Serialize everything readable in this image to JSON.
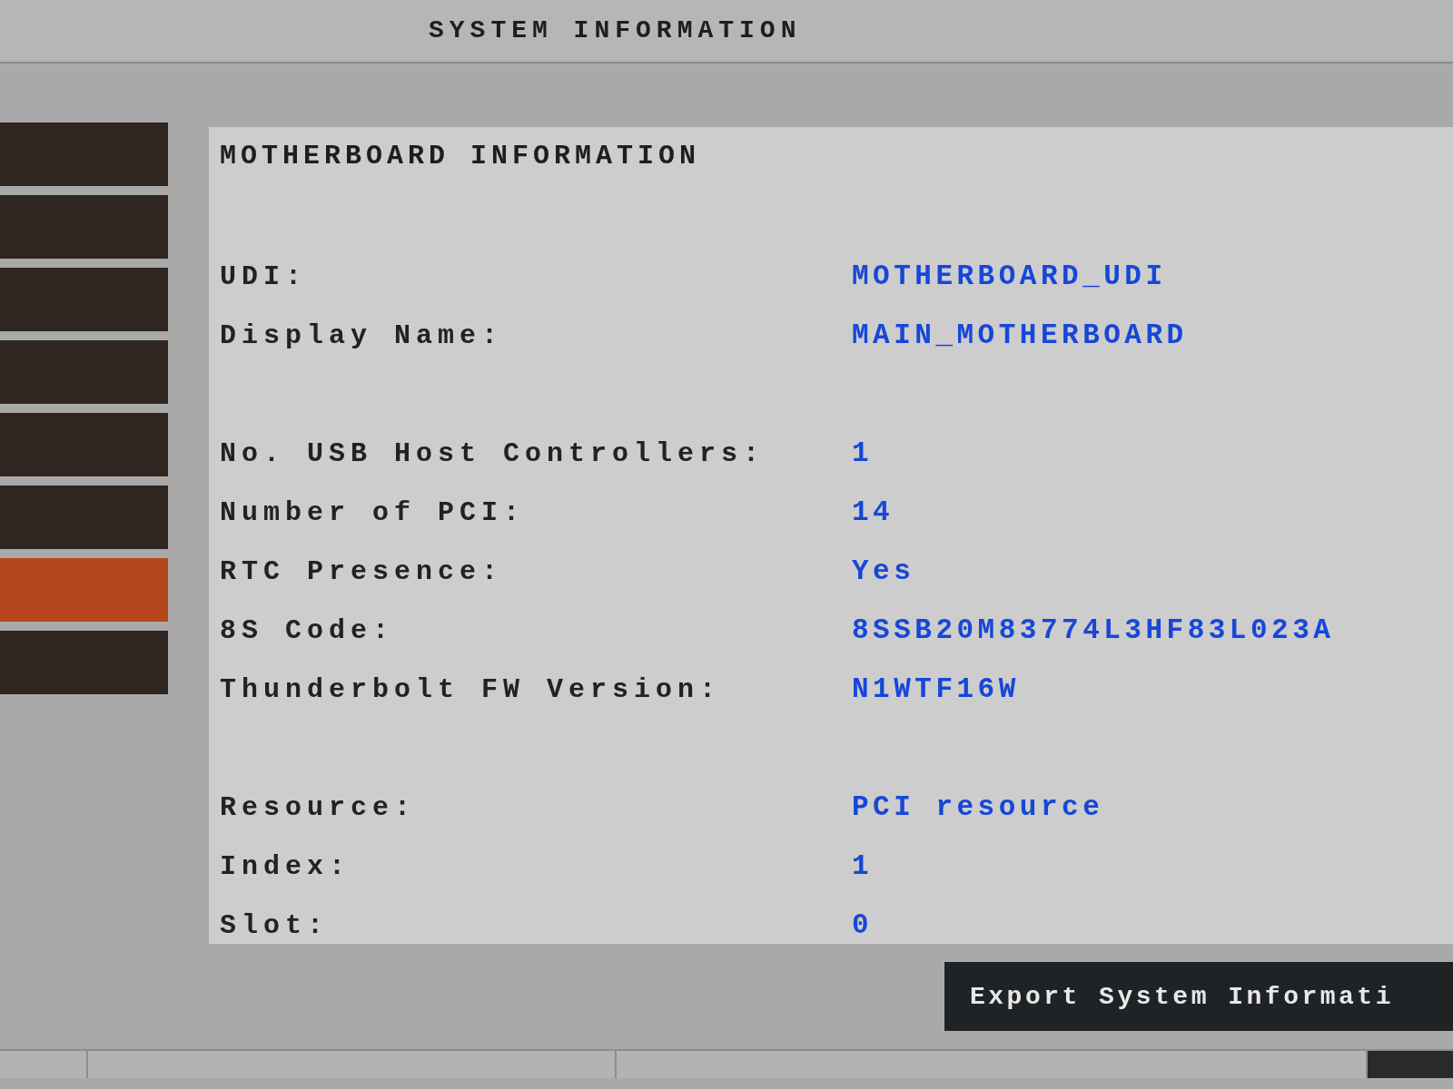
{
  "header": {
    "title": "SYSTEM INFORMATION"
  },
  "sidebar": {
    "items": [
      {
        "selected": false
      },
      {
        "selected": false
      },
      {
        "selected": false
      },
      {
        "selected": false
      },
      {
        "selected": false
      },
      {
        "selected": false
      },
      {
        "selected": true
      },
      {
        "selected": false
      }
    ]
  },
  "panel": {
    "title": "MOTHERBOARD INFORMATION",
    "groups": [
      [
        {
          "label": "UDI:",
          "value": "MOTHERBOARD_UDI"
        },
        {
          "label": "Display Name:",
          "value": "MAIN_MOTHERBOARD"
        }
      ],
      [
        {
          "label": "No. USB Host Controllers:",
          "value": "1"
        },
        {
          "label": "Number of PCI:",
          "value": "14"
        },
        {
          "label": "RTC Presence:",
          "value": "Yes"
        },
        {
          "label": "8S Code:",
          "value": "8SSB20M83774L3HF83L023A"
        },
        {
          "label": "Thunderbolt FW Version:",
          "value": "N1WTF16W"
        }
      ],
      [
        {
          "label": "Resource:",
          "value": "PCI resource"
        },
        {
          "label": "Index:",
          "value": "1"
        },
        {
          "label": "Slot:",
          "value": "0"
        }
      ]
    ]
  },
  "buttons": [
    {
      "label": "Export System Informati"
    }
  ]
}
